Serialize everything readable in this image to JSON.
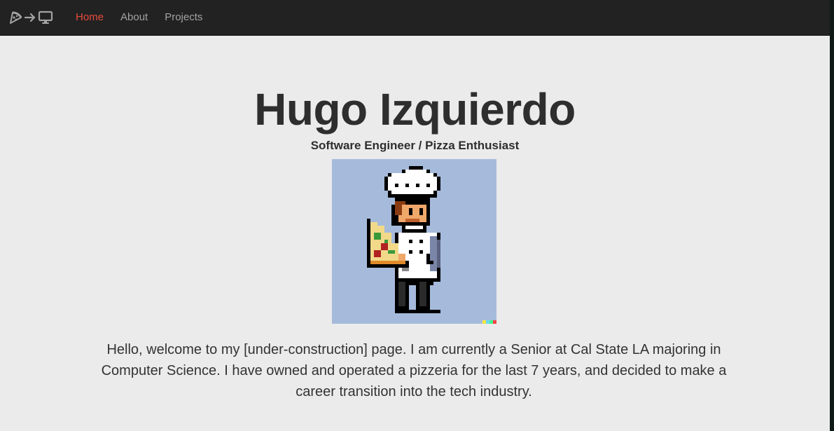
{
  "nav": {
    "brand_icons": [
      "pizza-icon",
      "arrow-right-icon",
      "monitor-icon"
    ],
    "links": [
      {
        "label": "Home",
        "active": true
      },
      {
        "label": "About",
        "active": false
      },
      {
        "label": "Projects",
        "active": false
      }
    ]
  },
  "hero": {
    "name": "Hugo Izquierdo",
    "tagline": "Software Engineer / Pizza Enthusiast",
    "intro": "Hello, welcome to my [under-construction] page. I am currently a Senior at Cal State LA majoring in Computer Science. I have owned and operated a pizzeria for the last 7 years, and decided to make a career transition into the tech industry."
  },
  "colors": {
    "navbar_bg": "#222222",
    "nav_active": "#e74c3c",
    "nav_inactive": "#a3a3a3",
    "page_bg": "#ebebeb",
    "avatar_bg": "#a6bbdc"
  }
}
